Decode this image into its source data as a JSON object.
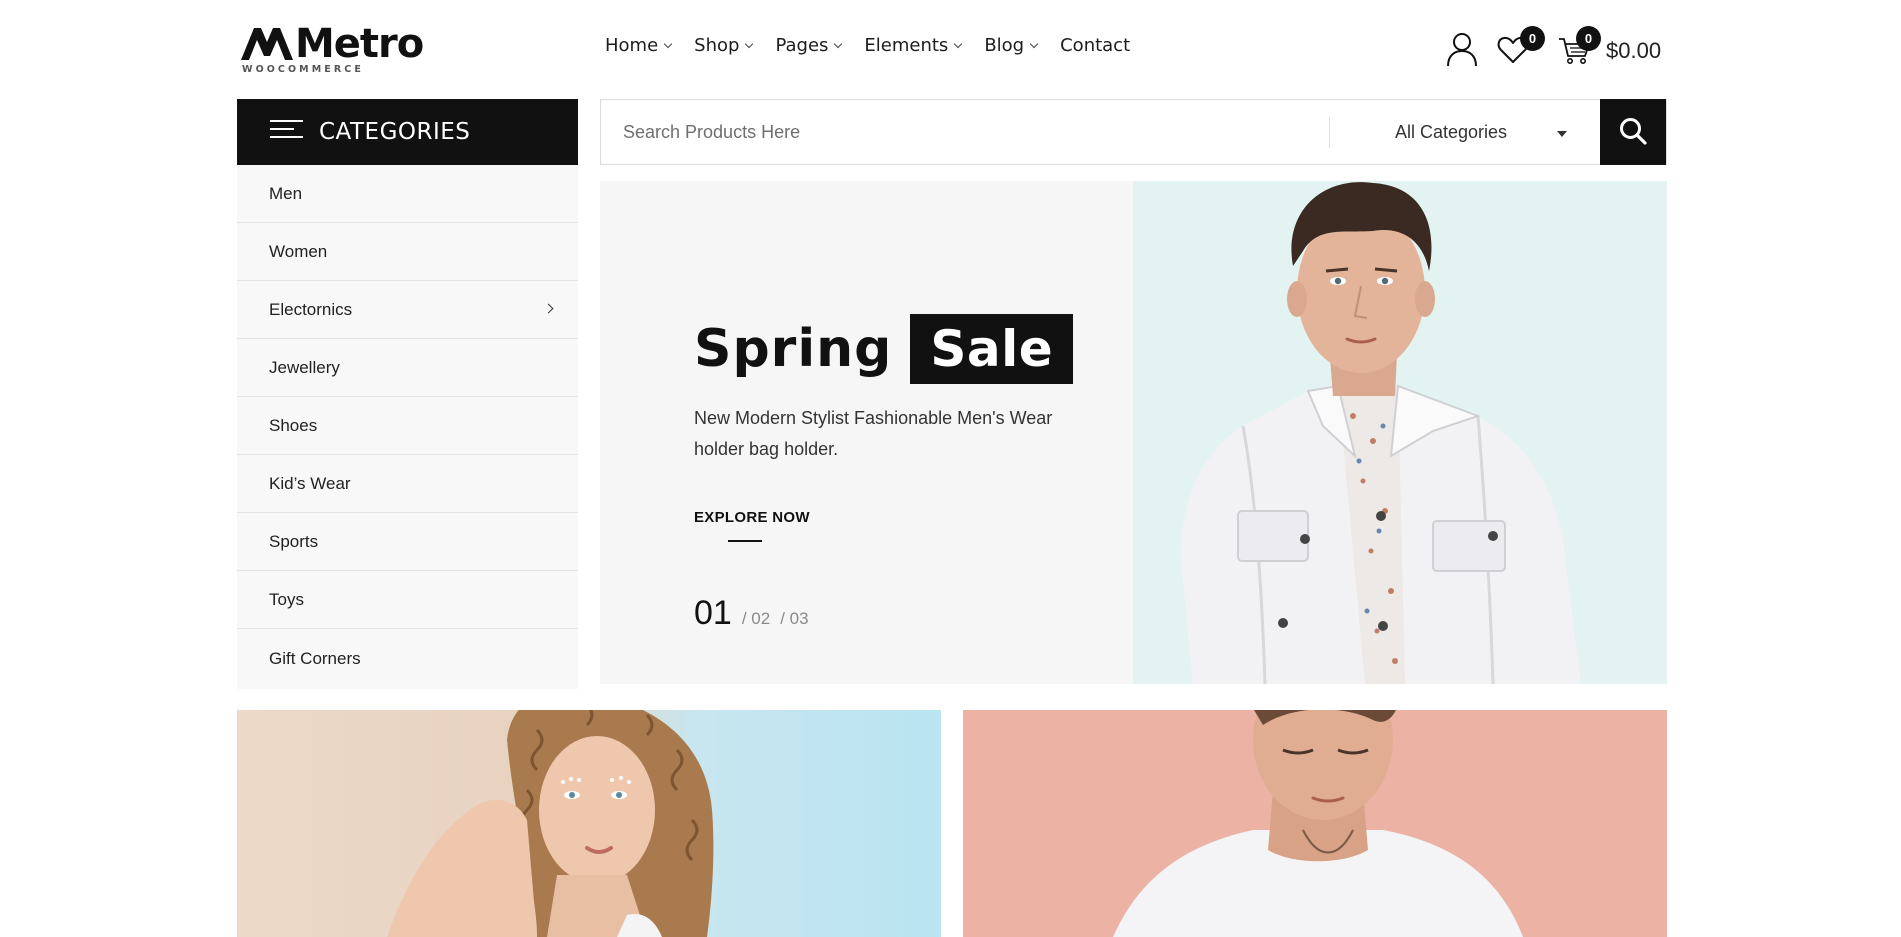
{
  "brand": {
    "name": "Metro",
    "tagline": "WOOCOMMERCE"
  },
  "nav": [
    {
      "label": "Home",
      "dropdown": true
    },
    {
      "label": "Shop",
      "dropdown": true
    },
    {
      "label": "Pages",
      "dropdown": true
    },
    {
      "label": "Elements",
      "dropdown": true
    },
    {
      "label": "Blog",
      "dropdown": true
    },
    {
      "label": "Contact",
      "dropdown": false
    }
  ],
  "header": {
    "wishlist_count": "0",
    "cart_count": "0",
    "cart_total": "$0.00",
    "icons": [
      "user-icon",
      "heart-icon",
      "cart-icon"
    ]
  },
  "categories": {
    "title": "CATEGORIES",
    "items": [
      {
        "label": "Men"
      },
      {
        "label": "Women"
      },
      {
        "label": "Electornics"
      },
      {
        "label": "Jewellery"
      },
      {
        "label": "Shoes"
      },
      {
        "label": "Kid’s Wear"
      },
      {
        "label": "Sports"
      },
      {
        "label": "Toys"
      },
      {
        "label": "Gift Corners"
      }
    ]
  },
  "search": {
    "placeholder": "Search Products Here",
    "value": "",
    "category": "All Categories"
  },
  "hero": {
    "title_plain": "Spring",
    "title_highlight": "Sale",
    "description": "New Modern Stylist Fashionable Men's Wear holder bag holder.",
    "cta": "EXPLORE NOW",
    "slide_current": "01",
    "slide_others": [
      "/ 02",
      "/ 03"
    ]
  },
  "colors": {
    "primary": "#111111",
    "hero_bg": "#f6f6f6",
    "hero_image_bg": "#e2f3f2",
    "banner_right_bg": "#ecb3a5",
    "banner_left_bg": "#b9e4f1"
  }
}
